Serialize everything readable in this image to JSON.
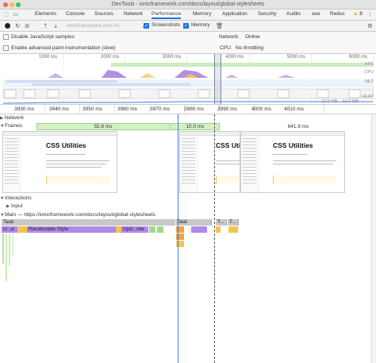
{
  "window": {
    "title": "DevTools - ionicframework.com/docs/layout/global-stylesheets"
  },
  "tabs": [
    {
      "label": "Elements"
    },
    {
      "label": "Console"
    },
    {
      "label": "Sources"
    },
    {
      "label": "Network"
    },
    {
      "label": "Performance"
    },
    {
      "label": "Memory"
    },
    {
      "label": "Application"
    },
    {
      "label": "Security"
    },
    {
      "label": "Audits"
    },
    {
      "label": "axe"
    },
    {
      "label": "Redux"
    }
  ],
  "warnings": {
    "count": "8"
  },
  "toolbar": {
    "profile": "ionicframework.com #1",
    "screenshots_label": "Screenshots",
    "memory_label": "Memory"
  },
  "settings": {
    "disable_js_samples": "Disable JavaScript samples",
    "advanced_paint": "Enable advanced paint instrumentation (slow)",
    "network_label": "Network:",
    "network_value": "Online",
    "cpu_label": "CPU:",
    "cpu_value": "No throttling"
  },
  "overview": {
    "ticks": [
      "1000 ms",
      "2000 ms",
      "3000 ms",
      "4000 ms",
      "5000 ms",
      "6000 ms"
    ],
    "lanes": [
      "FPS",
      "CPU",
      "NET",
      "HEAP"
    ],
    "heap_range": "12.5 MB – 21.0 MB"
  },
  "ruler": {
    "ticks": [
      "3930 ms",
      "3940 ms",
      "3950 ms",
      "3960 ms",
      "3970 ms",
      "3980 ms",
      "3990 ms",
      "4000 ms",
      "4010 ms"
    ]
  },
  "tracks": {
    "network": "Network",
    "frames": "Frames",
    "interactions": "Interactions",
    "input": "Input",
    "main": "Main — https://ionicframework.com/docs/layout/global-stylesheets"
  },
  "frames": {
    "f1": "55.6 ms",
    "f2": "10.0 ms",
    "f3": "641.9 ms"
  },
  "screenshots": {
    "heading1": "CSS Utilities",
    "heading2": "CSS Uti",
    "heading3": "CSS Utilities"
  },
  "main": {
    "task1": "Task",
    "task2": "Task",
    "task3": "T...",
    "task4": "T...",
    "recalc_u": "U...e",
    "recalc": "Recalculate Style",
    "update": "Upd...ree"
  }
}
